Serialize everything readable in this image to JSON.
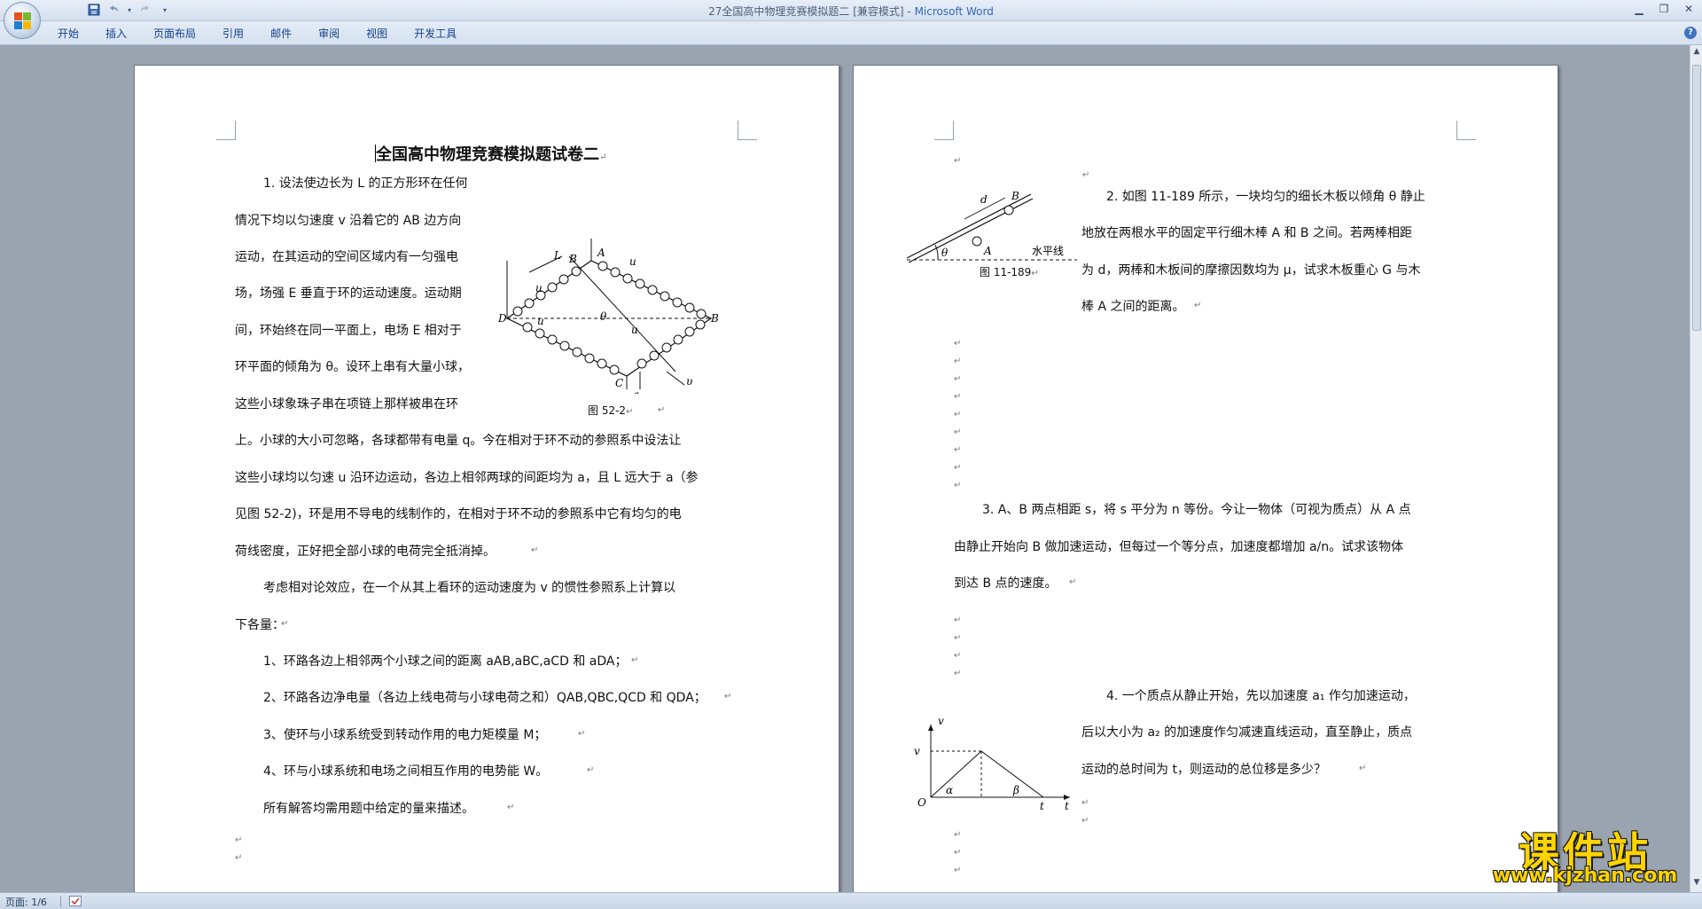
{
  "window": {
    "title": "27全国高中物理竞赛模拟题二 [兼容模式]",
    "app_name": "Microsoft Word"
  },
  "ribbon": {
    "tabs": [
      "开始",
      "插入",
      "页面布局",
      "引用",
      "邮件",
      "审阅",
      "视图",
      "开发工具"
    ]
  },
  "icons": {
    "office_button": "office-logo-icon",
    "save": "save-icon",
    "undo": "undo-icon",
    "redo": "redo-icon",
    "customize": "chevron-down-icon",
    "minimize": "minimize-icon",
    "restore": "restore-icon",
    "close": "close-icon",
    "help": "help-icon",
    "spell_check": "spell-check-icon"
  },
  "page1": {
    "heading": "全国高中物理竞赛模拟题试卷二",
    "p1_lines": [
      "1. 设法使边长为 L 的正方形环在任何",
      "情况下均以匀速度 v 沿着它的 AB 边方向",
      "运动，在其运动的空间区域内有一匀强电",
      "场，场强 E 垂直于环的运动速度。运动期",
      "间，环始终在同一平面上，电场 E 相对于",
      "环平面的倾角为 θ。设环上串有大量小球，",
      "这些小球象珠子串在项链上那样被串在环",
      "上。小球的大小可忽略，各球都带有电量 q。今在相对于环不动的参照系中设法让",
      "这些小球均以匀速 u 沿环边运动，各边上相邻两球的间距均为 a，且 L 远大于 a（参",
      "见图 52-2)，环是用不导电的线制作的，在相对于环不动的参照系中它有均匀的电",
      "荷线密度，正好把全部小球的电荷完全抵消掉。"
    ],
    "p2_lines": [
      "考虑相对论效应，在一个从其上看环的运动速度为 v 的惯性参照系上计算以",
      "下各量："
    ],
    "list": [
      "1、环路各边上相邻两个小球之间的距离 aAB,aBC,aCD 和 aDA；",
      "2、环路各边净电量（各边上线电荷与小球电荷之和）QAB,QBC,QCD 和 QDA；",
      "3、使环与小球系统受到转动作用的电力矩模量 M；",
      "4、环与小球系统和电场之间相互作用的电势能 W。"
    ],
    "closing": "所有解答均需用题中给定的量来描述。",
    "figure_caption": "图 52-2",
    "figure_labels": [
      "L",
      "B",
      "A",
      "u",
      "u",
      "D",
      "u",
      "θ",
      "u",
      "B",
      "C",
      "a",
      "υ"
    ]
  },
  "page2": {
    "q2_lines": [
      "2.  如图 11-189 所示，一块均匀的细长木板以倾角 θ 静止",
      "地放在两根水平的固定平行细木棒 A 和 B 之间。若两棒相距",
      "为 d，两棒和木板间的摩擦因数均为 μ，试求木板重心 G 与木",
      "棒 A 之间的距离。"
    ],
    "fig1_caption": "图 11-189",
    "fig1_labels": [
      "B",
      "d",
      "A",
      "θ",
      "水平线"
    ],
    "q3_lines": [
      "3. A、B 两点相距 s，将 s 平分为 n 等份。今让一物体（可视为质点）从 A 点",
      "由静止开始向 B 做加速运动，但每过一个等分点，加速度都增加 a/n。试求该物体",
      "到达 B 点的速度。"
    ],
    "q4_lines": [
      "4.  一个质点从静止开始，先以加速度 a₁ 作匀加速运动，",
      "后以大小为  a₂ 的加速度作匀减速直线运动，直至静止，质点",
      "运动的总时间为 t，则运动的总位移是多少？"
    ],
    "fig2_labels": [
      "v",
      "v",
      "O",
      "α",
      "β",
      "t",
      "t"
    ]
  },
  "status": {
    "page": "页面: 1/6"
  },
  "watermark": {
    "main": "课件站",
    "url": "www.kjzhan.com"
  },
  "paragraph_mark": "↵"
}
